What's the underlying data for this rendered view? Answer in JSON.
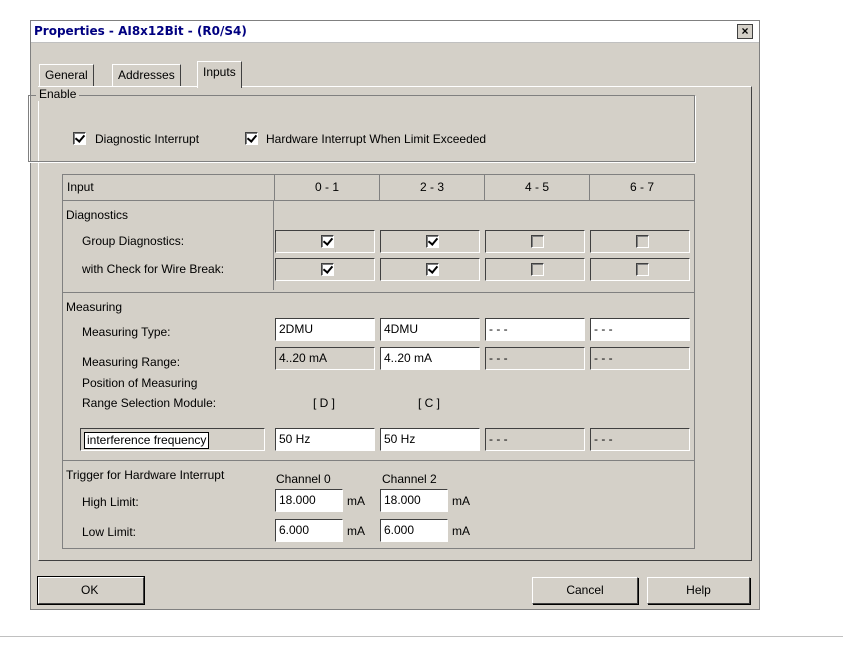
{
  "window": {
    "title": "Properties - AI8x12Bit - (R0/S4)",
    "close_glyph": "×"
  },
  "tabs": [
    {
      "label": "General",
      "active": false
    },
    {
      "label": "Addresses",
      "active": false
    },
    {
      "label": "Inputs",
      "active": true
    }
  ],
  "enable": {
    "title": "Enable",
    "diagnostic_interrupt": {
      "label": "Diagnostic Interrupt",
      "checked": true
    },
    "hardware_interrupt": {
      "label": "Hardware Interrupt When Limit Exceeded",
      "checked": true
    }
  },
  "grid": {
    "header": {
      "label": "Input",
      "columns": [
        "0 - 1",
        "2 - 3",
        "4 - 5",
        "6 - 7"
      ]
    },
    "diagnostics": {
      "title": "Diagnostics",
      "group_label": "Group Diagnostics:",
      "group_checked": [
        true,
        true,
        false,
        false
      ],
      "wire_label": "with Check for Wire Break:",
      "wire_checked": [
        true,
        true,
        false,
        false
      ]
    },
    "measuring": {
      "title": "Measuring",
      "type_label": "Measuring Type:",
      "types": [
        "2DMU",
        "4DMU",
        "- - -",
        "- - -"
      ],
      "range_label": "Measuring Range:",
      "ranges": [
        "4..20 mA",
        "4..20 mA",
        "- - -",
        "- - -"
      ],
      "position_label_1": "Position of Measuring",
      "position_label_2": "Range Selection Module:",
      "positions": [
        "[ D ]",
        "[ C ]"
      ],
      "interference_label": "interference frequency",
      "frequencies": [
        "50 Hz",
        "50 Hz",
        "- - -",
        "- - -"
      ]
    },
    "trigger": {
      "title": "Trigger for Hardware Interrupt",
      "channel_0": "Channel 0",
      "channel_2": "Channel 2",
      "high_label": "High Limit:",
      "high_values": [
        "18.000",
        "18.000"
      ],
      "low_label": "Low Limit:",
      "low_values": [
        "6.000",
        "6.000"
      ],
      "unit": "mA"
    }
  },
  "buttons": {
    "ok": "OK",
    "cancel": "Cancel",
    "help": "Help"
  }
}
